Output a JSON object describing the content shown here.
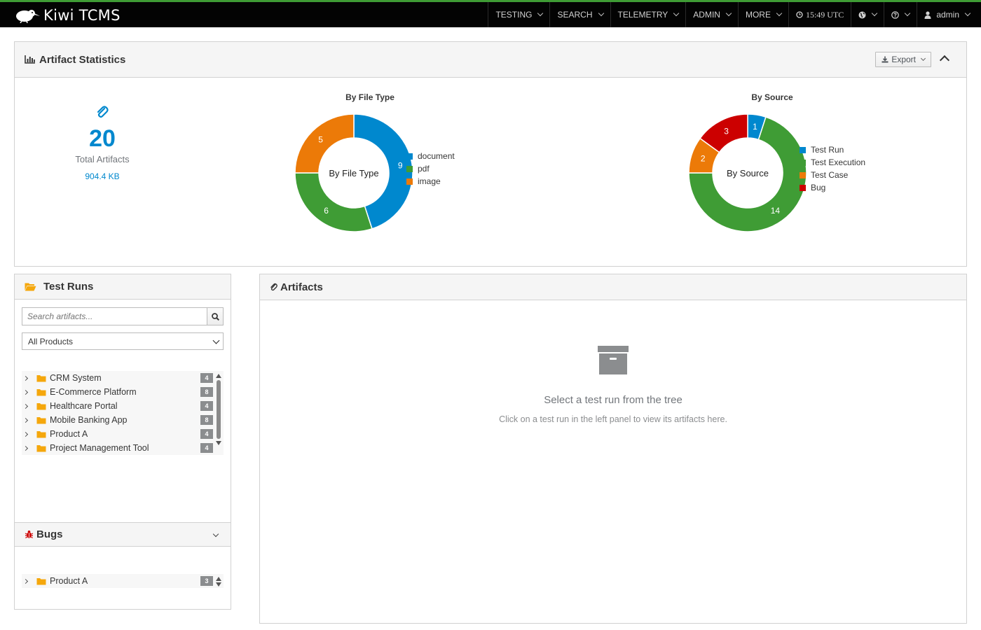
{
  "app": {
    "brand": "Kiwi TCMS",
    "accent_color": "#3f9c35",
    "navbar_bg": "#030303"
  },
  "nav": {
    "items": [
      {
        "label": "TESTING",
        "icon": null
      },
      {
        "label": "SEARCH",
        "icon": null
      },
      {
        "label": "TELEMETRY",
        "icon": null
      },
      {
        "label": "ADMIN",
        "icon": null
      },
      {
        "label": "MORE",
        "icon": null
      }
    ],
    "clock": "15:49 UTC",
    "globe_icon": "globe-icon",
    "help_icon": "question-circle-icon",
    "user": "admin"
  },
  "stats": {
    "title": "Artifact Statistics",
    "export_label": "Export",
    "total_count": "20",
    "total_label": "Total Artifacts",
    "total_size": "904.4 KB"
  },
  "chart_data": [
    {
      "type": "pie",
      "title": "By File Type",
      "center_label": "By File Type",
      "categories": [
        "document",
        "pdf",
        "image"
      ],
      "values": [
        9,
        6,
        5
      ],
      "colors": [
        "#0088ce",
        "#3f9c35",
        "#ec7a08"
      ]
    },
    {
      "type": "pie",
      "title": "By Source",
      "center_label": "By Source",
      "categories": [
        "Test Run",
        "Test Execution",
        "Test Case",
        "Bug"
      ],
      "values": [
        1,
        14,
        2,
        3
      ],
      "colors": [
        "#0088ce",
        "#3f9c35",
        "#ec7a08",
        "#cc0000"
      ]
    }
  ],
  "test_runs": {
    "title": "Test Runs",
    "search_placeholder": "Search artifacts...",
    "product_filter": "All Products",
    "tree": [
      {
        "label": "CRM System",
        "count": "4"
      },
      {
        "label": "E-Commerce Platform",
        "count": "8"
      },
      {
        "label": "Healthcare Portal",
        "count": "4"
      },
      {
        "label": "Mobile Banking App",
        "count": "8"
      },
      {
        "label": "Product A",
        "count": "4"
      },
      {
        "label": "Project Management Tool",
        "count": "4"
      }
    ]
  },
  "bugs": {
    "title": "Bugs",
    "tree": [
      {
        "label": "Product A",
        "count": "3"
      }
    ]
  },
  "artifacts": {
    "title": "Artifacts",
    "empty_title": "Select a test run from the tree",
    "empty_subtitle": "Click on a test run in the left panel to view its artifacts here."
  }
}
